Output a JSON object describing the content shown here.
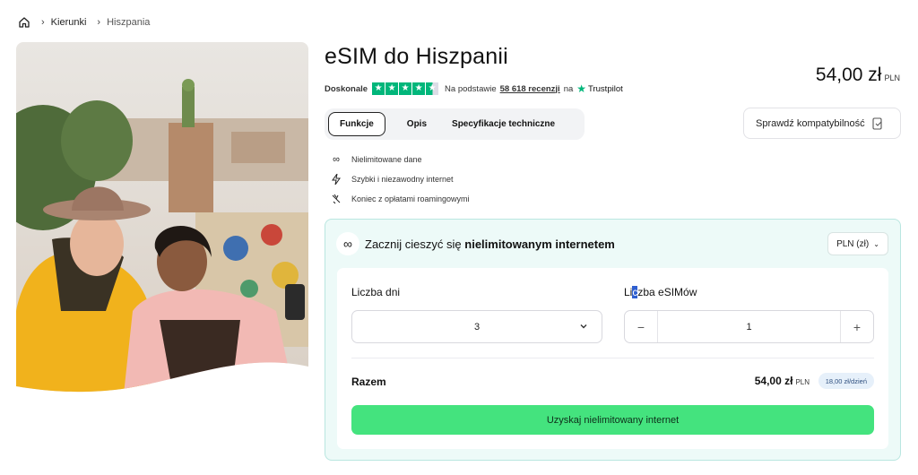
{
  "breadcrumb": {
    "home_icon": "home-icon",
    "items": [
      "Kierunki",
      "Hiszpania"
    ]
  },
  "product": {
    "title": "eSIM do Hiszpanii",
    "price": "54,00 zł",
    "currency": "PLN"
  },
  "rating": {
    "label": "Doskonale",
    "stars": 4.5,
    "text_before": "Na podstawie",
    "reviews": "58 618 recenzji",
    "text_after": "na",
    "brand": "Trustpilot"
  },
  "tabs": [
    {
      "label": "Funkcje",
      "active": true
    },
    {
      "label": "Opis",
      "active": false
    },
    {
      "label": "Specyfikacje techniczne",
      "active": false
    }
  ],
  "compat_button": "Sprawdź kompatybilność",
  "features": [
    {
      "icon": "infinity-icon",
      "text": "Nielimitowane dane"
    },
    {
      "icon": "lightning-icon",
      "text": "Szybki i niezawodny internet"
    },
    {
      "icon": "no-roaming-icon",
      "text": "Koniec z opłatami roamingowymi"
    }
  ],
  "config": {
    "heading_pre": "Zacznij cieszyć się",
    "heading_bold": "nielimitowanym internetem",
    "currency_select": "PLN (zł)",
    "days_label": "Liczba dni",
    "days_value": "3",
    "esims_label_a": "Li",
    "esims_label_hl": "c",
    "esims_label_b": "zba eSIMów",
    "esims_value": "1",
    "minus": "−",
    "plus": "+",
    "total_label": "Razem",
    "total_amount": "54,00 zł",
    "total_currency": "PLN",
    "per_day": "18,00 zł/dzień",
    "cta": "Uzyskaj nielimitowany internet"
  },
  "colors": {
    "accent_green": "#44e37e",
    "trustpilot_green": "#00b67a",
    "card_bg": "#edfaf8"
  }
}
